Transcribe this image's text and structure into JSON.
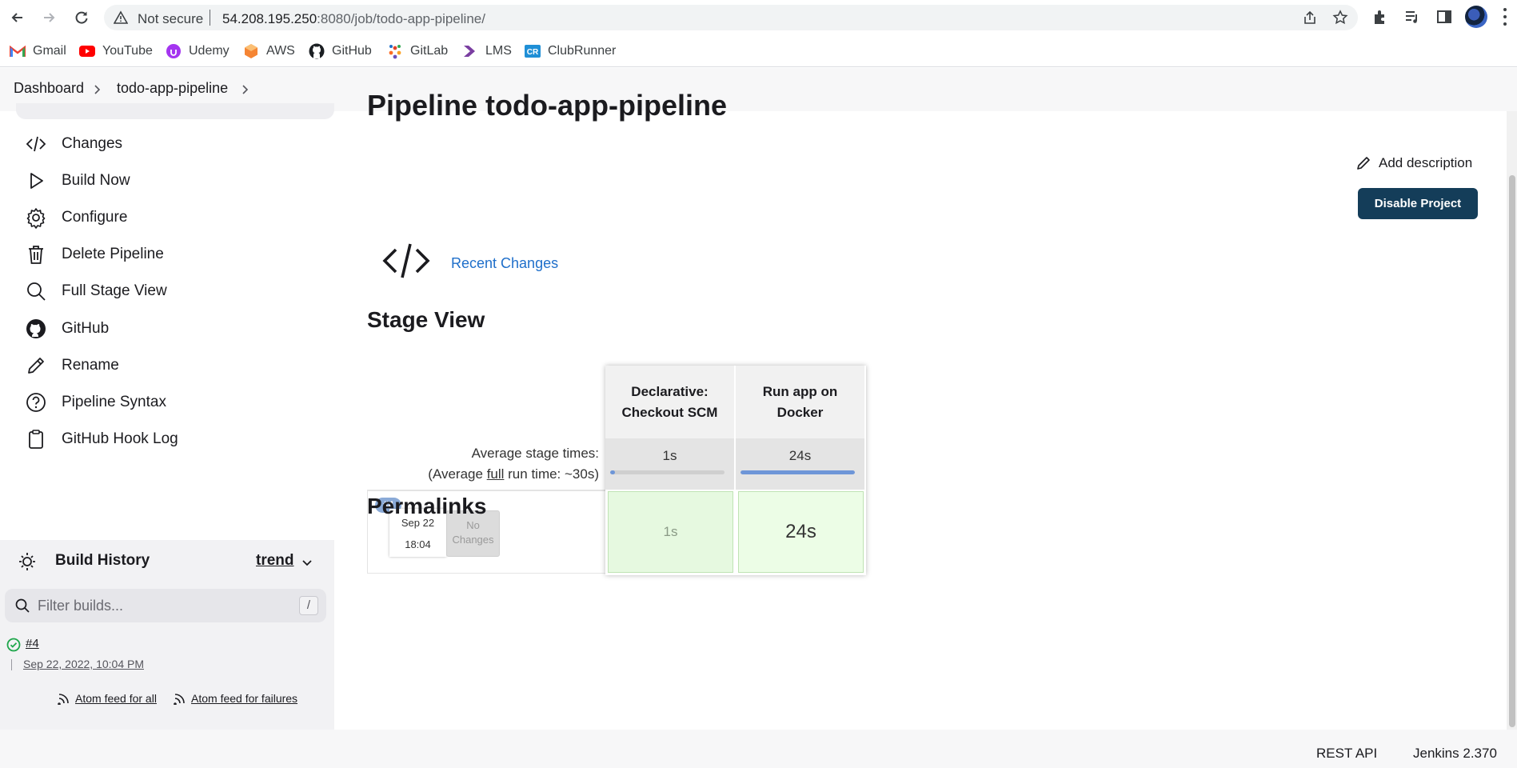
{
  "browser": {
    "security_label": "Not secure",
    "url_host": "54.208.195.250",
    "url_rest": ":8080/job/todo-app-pipeline/"
  },
  "bookmarks": [
    {
      "label": "Gmail",
      "icon": "gmail-icon"
    },
    {
      "label": "YouTube",
      "icon": "youtube-icon"
    },
    {
      "label": "Udemy",
      "icon": "udemy-icon"
    },
    {
      "label": "AWS",
      "icon": "aws-icon"
    },
    {
      "label": "GitHub",
      "icon": "github-icon"
    },
    {
      "label": "GitLab",
      "icon": "gitlab-icon"
    },
    {
      "label": "LMS",
      "icon": "lms-icon"
    },
    {
      "label": "ClubRunner",
      "icon": "clubrunner-icon"
    }
  ],
  "breadcrumb": {
    "items": [
      "Dashboard",
      "todo-app-pipeline"
    ]
  },
  "sidebar": {
    "tasks": [
      {
        "label": "Changes",
        "icon": "code-icon"
      },
      {
        "label": "Build Now",
        "icon": "play-icon"
      },
      {
        "label": "Configure",
        "icon": "gear-icon"
      },
      {
        "label": "Delete Pipeline",
        "icon": "trash-icon"
      },
      {
        "label": "Full Stage View",
        "icon": "search-icon"
      },
      {
        "label": "GitHub",
        "icon": "github-icon"
      },
      {
        "label": "Rename",
        "icon": "pencil-icon"
      },
      {
        "label": "Pipeline Syntax",
        "icon": "help-icon"
      },
      {
        "label": "GitHub Hook Log",
        "icon": "clipboard-icon"
      }
    ]
  },
  "build_history": {
    "title": "Build History",
    "trend_label": "trend",
    "filter_placeholder": "Filter builds...",
    "filter_shortcut": "/",
    "builds": [
      {
        "number": "#4",
        "date": "Sep 22, 2022, 10:04 PM",
        "status": "success"
      }
    ],
    "feed_all": "Atom feed for all",
    "feed_failures": "Atom feed for failures"
  },
  "main": {
    "page_title": "Pipeline todo-app-pipeline",
    "add_description": "Add description",
    "disable_button": "Disable Project",
    "recent_changes": "Recent Changes",
    "stage_view_heading": "Stage View",
    "permalinks_heading": "Permalinks"
  },
  "stage_view": {
    "avg_label": "Average stage times:",
    "avg_full_prefix": "(Average ",
    "avg_full_word": "full",
    "avg_full_suffix": " run time: ~30s)",
    "stages": [
      {
        "name_line1": "Declarative:",
        "name_line2": "Checkout SCM",
        "avg_time": "1s",
        "avg_fraction": 0.04
      },
      {
        "name_line1": "Run app on",
        "name_line2": "Docker",
        "avg_time": "24s",
        "avg_fraction": 1.0
      }
    ],
    "runs": [
      {
        "badge": "#4",
        "date": "Sep 22",
        "time": "18:04",
        "changes_line1": "No",
        "changes_line2": "Changes",
        "stage_times": [
          "1s",
          "24s"
        ]
      }
    ]
  },
  "footer": {
    "rest_api": "REST API",
    "version": "Jenkins 2.370"
  },
  "colors": {
    "primary_button": "#143d59",
    "link": "#1f6fca",
    "stage_success": "#e6f9e0",
    "progress_fill": "#6e96d8"
  }
}
